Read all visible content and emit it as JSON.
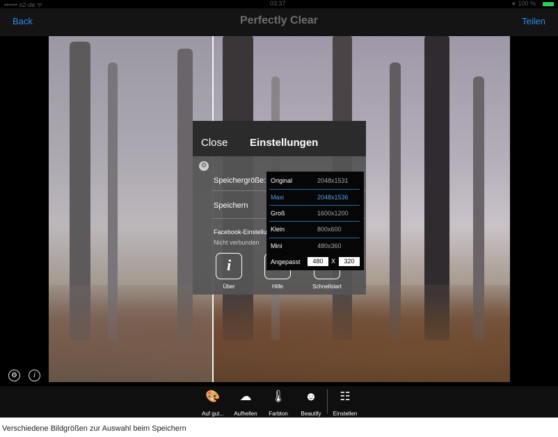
{
  "status_bar": {
    "left": "•••••• o2-de ᯤ",
    "time": "03:37",
    "right": "∗ 100 %"
  },
  "nav": {
    "back_label": "Back",
    "title": "Perfectly Clear",
    "share_label": "Teilen"
  },
  "modal": {
    "close_label": "Close",
    "title": "Einstellungen",
    "storage_size_label": "Speichergröße:",
    "save_label": "Speichern",
    "facebook_label": "Facebook-Einstellu",
    "facebook_status": "Nicht verbunden",
    "tiles": [
      {
        "icon": "info-icon",
        "glyph": "i",
        "label": "Über"
      },
      {
        "icon": "help-icon",
        "glyph": "?",
        "label": "Hilfe"
      },
      {
        "icon": "quickstart-icon",
        "glyph": "↺",
        "label": "Schnellstart"
      }
    ]
  },
  "size_options": [
    {
      "name": "Original",
      "size": "2048x1531",
      "selected": false
    },
    {
      "name": "Maxi",
      "size": "2048x1536",
      "selected": true
    },
    {
      "name": "Groß",
      "size": "1600x1200",
      "selected": false
    },
    {
      "name": "Klein",
      "size": "800x600",
      "selected": false
    },
    {
      "name": "Mini",
      "size": "480x360",
      "selected": false
    }
  ],
  "custom_size": {
    "label": "Angepasst",
    "width": "480",
    "separator": "X",
    "height": "320"
  },
  "toolbar": [
    {
      "icon": "palette-icon",
      "glyph": "🎨",
      "label": "Auf gut..."
    },
    {
      "icon": "cloud-icon",
      "glyph": "☁",
      "label": "Aufhellen"
    },
    {
      "icon": "thermometer-icon",
      "glyph": "🌡",
      "label": "Farbton"
    },
    {
      "icon": "face-icon",
      "glyph": "☻",
      "label": "Beautify"
    },
    {
      "icon": "sliders-icon",
      "glyph": "☷",
      "label": "Einstellen"
    }
  ],
  "caption": "Verschiedene Bildgrößen zur Auswahl beim Speichern",
  "colors": {
    "accent": "#2c8cf0",
    "selected": "#4ba3ee",
    "battery": "#27d35b"
  }
}
